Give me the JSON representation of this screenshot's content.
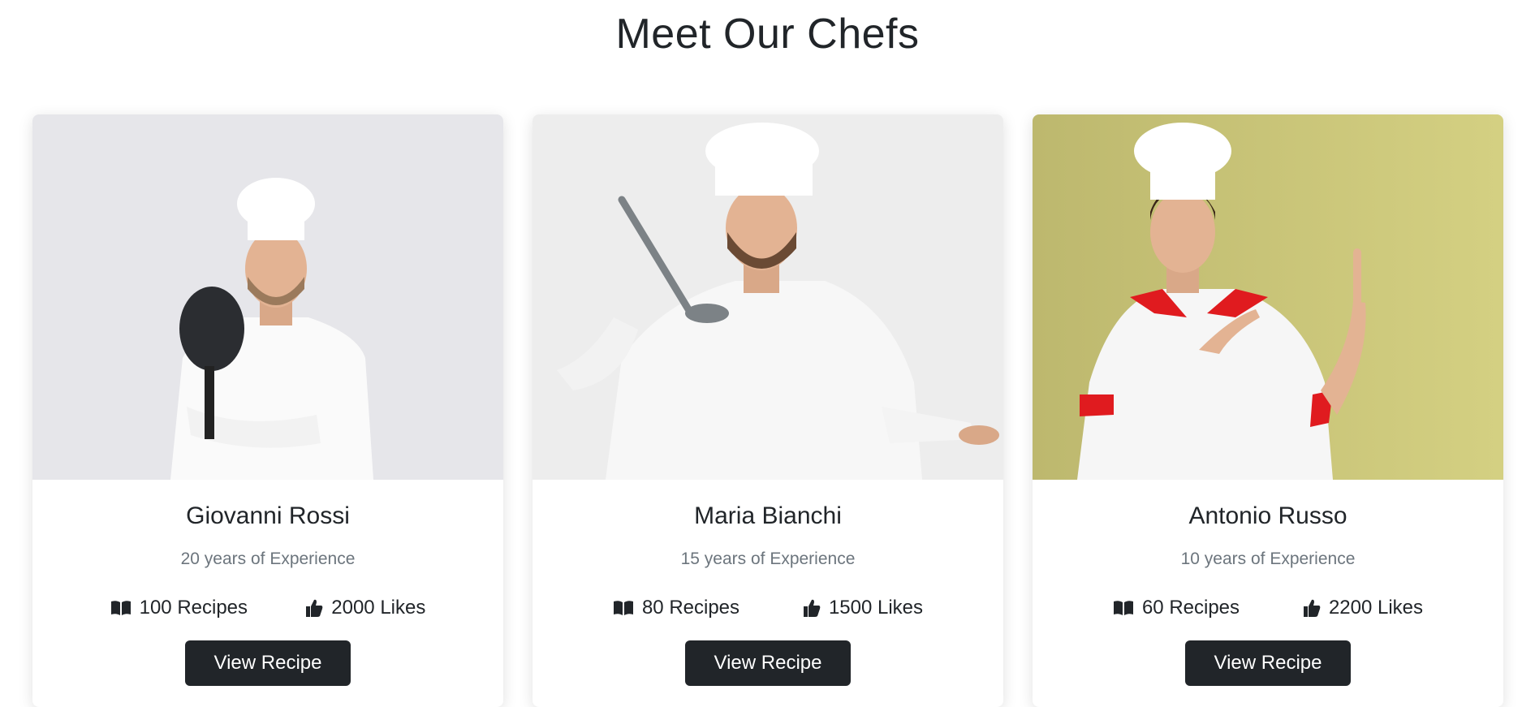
{
  "section": {
    "title": "Meet Our Chefs"
  },
  "chefs": [
    {
      "name": "Giovanni Rossi",
      "experience": "20 years of Experience",
      "recipes": "100 Recipes",
      "likes": "2000 Likes",
      "button": "View Recipe",
      "photo_bg": "#e6e6ea"
    },
    {
      "name": "Maria Bianchi",
      "experience": "15 years of Experience",
      "recipes": "80 Recipes",
      "likes": "1500 Likes",
      "button": "View Recipe",
      "photo_bg": "#ededed"
    },
    {
      "name": "Antonio Russo",
      "experience": "10 years of Experience",
      "recipes": "60 Recipes",
      "likes": "2200 Likes",
      "button": "View Recipe",
      "photo_bg": "#c4c079"
    }
  ],
  "icons": {
    "recipes": "open-book-icon",
    "likes": "thumbs-up-icon"
  }
}
